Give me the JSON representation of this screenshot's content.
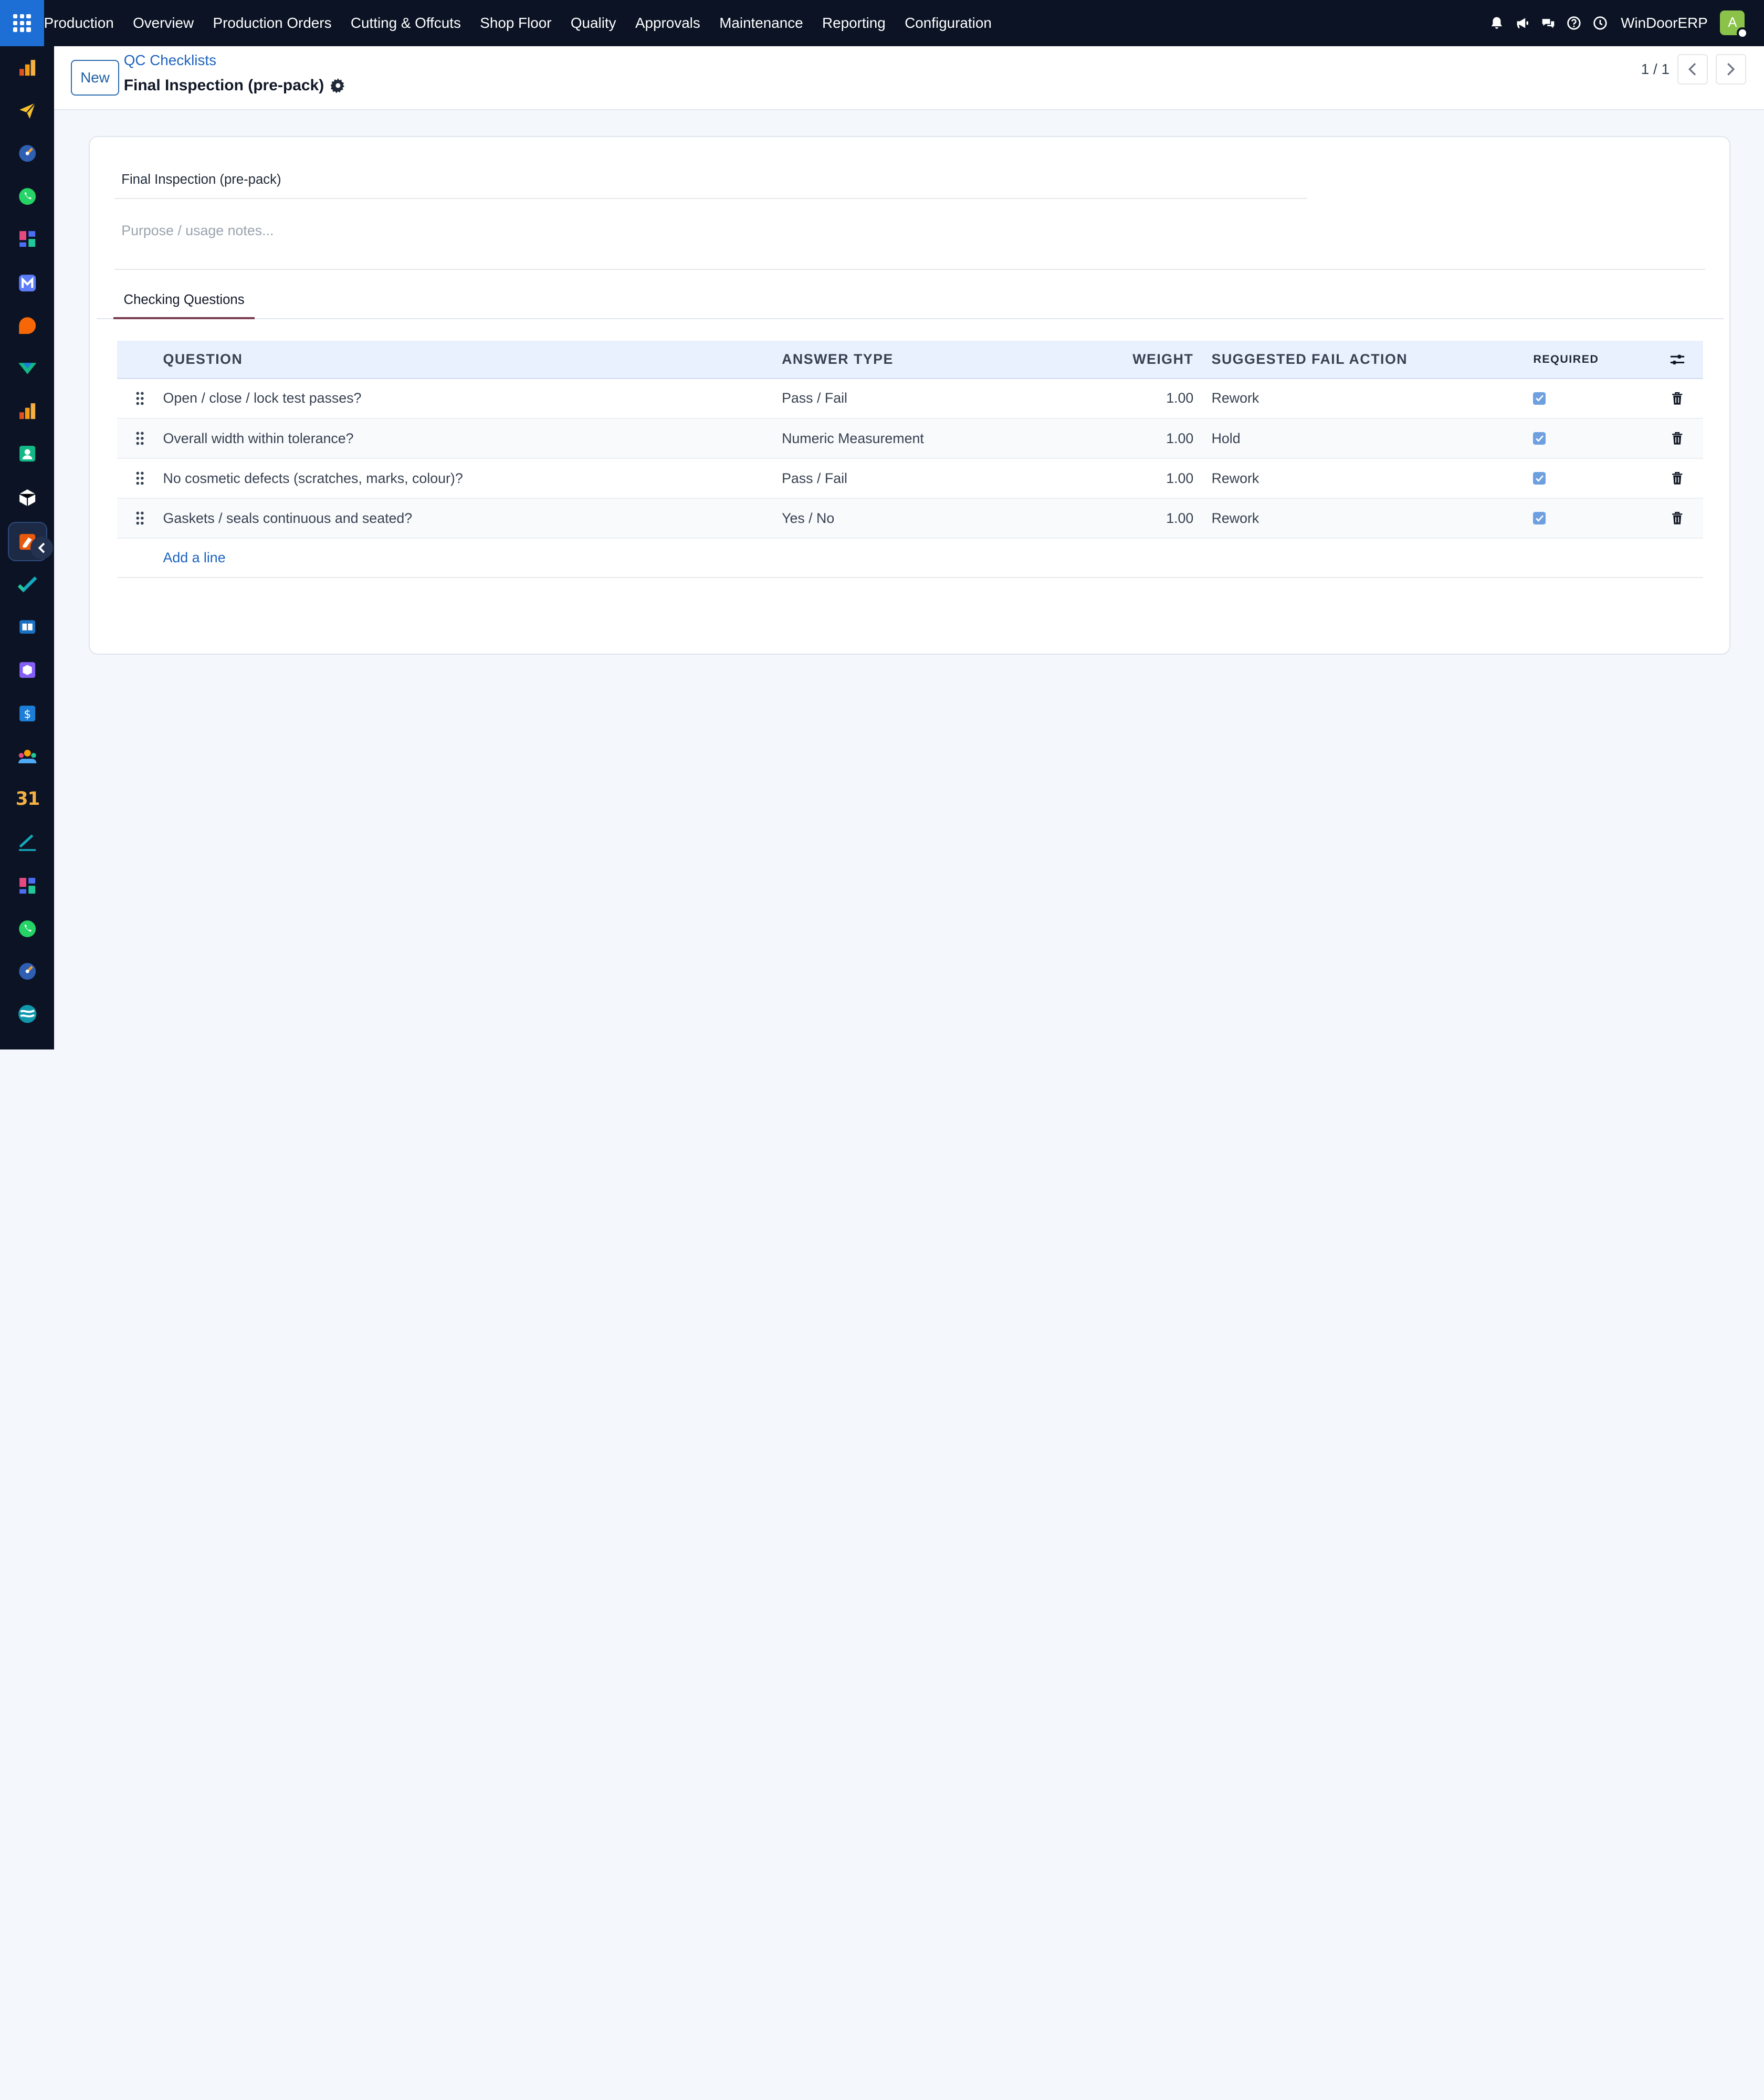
{
  "topbar": {
    "menu": [
      "Production",
      "Overview",
      "Production Orders",
      "Cutting & Offcuts",
      "Shop Floor",
      "Quality",
      "Approvals",
      "Maintenance",
      "Reporting",
      "Configuration"
    ],
    "company": "WinDoorERP",
    "avatar_letter": "A",
    "icons": [
      "bell-icon",
      "megaphone-icon",
      "chat-icon",
      "help-icon",
      "clock-icon"
    ]
  },
  "rail": {
    "apps": [
      "chart-app-icon",
      "paper-plane-app-icon",
      "gauge-app-icon",
      "whatsapp-app-icon",
      "dashboard-app-icon",
      "mail-app-icon",
      "chat-bubble-app-icon",
      "delivery-app-icon",
      "chart-app-icon-2",
      "contacts-app-icon",
      "cube-app-icon",
      "quality-app-icon",
      "check-app-icon",
      "book-app-icon",
      "package-app-icon",
      "invoice-app-icon",
      "team-app-icon",
      "calendar-app-icon",
      "sign-app-icon",
      "dashboard-app-icon-2",
      "whatsapp-app-icon-2",
      "gauge-app-icon-2",
      "discuss-app-icon"
    ],
    "calendar_text": "31"
  },
  "control": {
    "new_label": "New",
    "breadcrumb": "QC Checklists",
    "title": "Final Inspection (pre-pack)",
    "pager": "1 / 1"
  },
  "form": {
    "name_value": "Final Inspection (pre-pack)",
    "notes_placeholder": "Purpose / usage notes..."
  },
  "tabs": [
    "Checking Questions"
  ],
  "table": {
    "columns": {
      "question": "QUESTION",
      "answer_type": "ANSWER TYPE",
      "weight": "WEIGHT",
      "fail_action": "SUGGESTED FAIL ACTION",
      "required": "REQUIRED"
    },
    "rows": [
      {
        "question": "Open / close / lock test passes?",
        "answer_type": "Pass / Fail",
        "weight": "1.00",
        "fail_action": "Rework",
        "required": true
      },
      {
        "question": "Overall width within tolerance?",
        "answer_type": "Numeric Measurement",
        "weight": "1.00",
        "fail_action": "Hold",
        "required": true
      },
      {
        "question": "No cosmetic defects (scratches, marks, colour)?",
        "answer_type": "Pass / Fail",
        "weight": "1.00",
        "fail_action": "Rework",
        "required": true
      },
      {
        "question": "Gaskets / seals continuous and seated?",
        "answer_type": "Yes / No",
        "weight": "1.00",
        "fail_action": "Rework",
        "required": true
      }
    ],
    "add_line": "Add a line"
  },
  "colors": {
    "topbar_bg": "#0b1324",
    "apps_button": "#1d6fd6",
    "link": "#1d63c0",
    "table_header_bg": "#e8f1fd",
    "checkbox": "#6ea0e0",
    "tab_underline": "#7a3e52"
  }
}
